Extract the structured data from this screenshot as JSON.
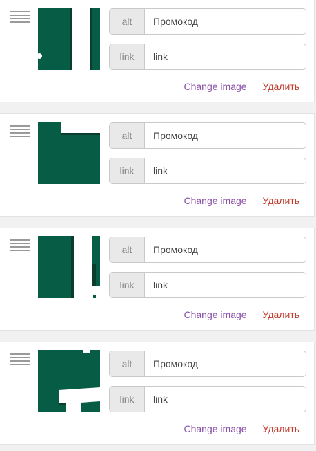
{
  "colors": {
    "thumb_green": "#075c45",
    "change_link": "#8a4fa7",
    "delete_link": "#c0392b"
  },
  "icons": {
    "drag": "drag-handle-icon"
  },
  "items": [
    {
      "alt_label": "alt",
      "alt_value": "Промокод",
      "link_label": "link",
      "link_value": "link",
      "change_label": "Change image",
      "delete_label": "Удалить"
    },
    {
      "alt_label": "alt",
      "alt_value": "Промокод",
      "link_label": "link",
      "link_value": "link",
      "change_label": "Change image",
      "delete_label": "Удалить"
    },
    {
      "alt_label": "alt",
      "alt_value": "Промокод",
      "link_label": "link",
      "link_value": "link",
      "change_label": "Change image",
      "delete_label": "Удалить"
    },
    {
      "alt_label": "alt",
      "alt_value": "Промокод",
      "link_label": "link",
      "link_value": "link",
      "change_label": "Change image",
      "delete_label": "Удалить"
    }
  ]
}
